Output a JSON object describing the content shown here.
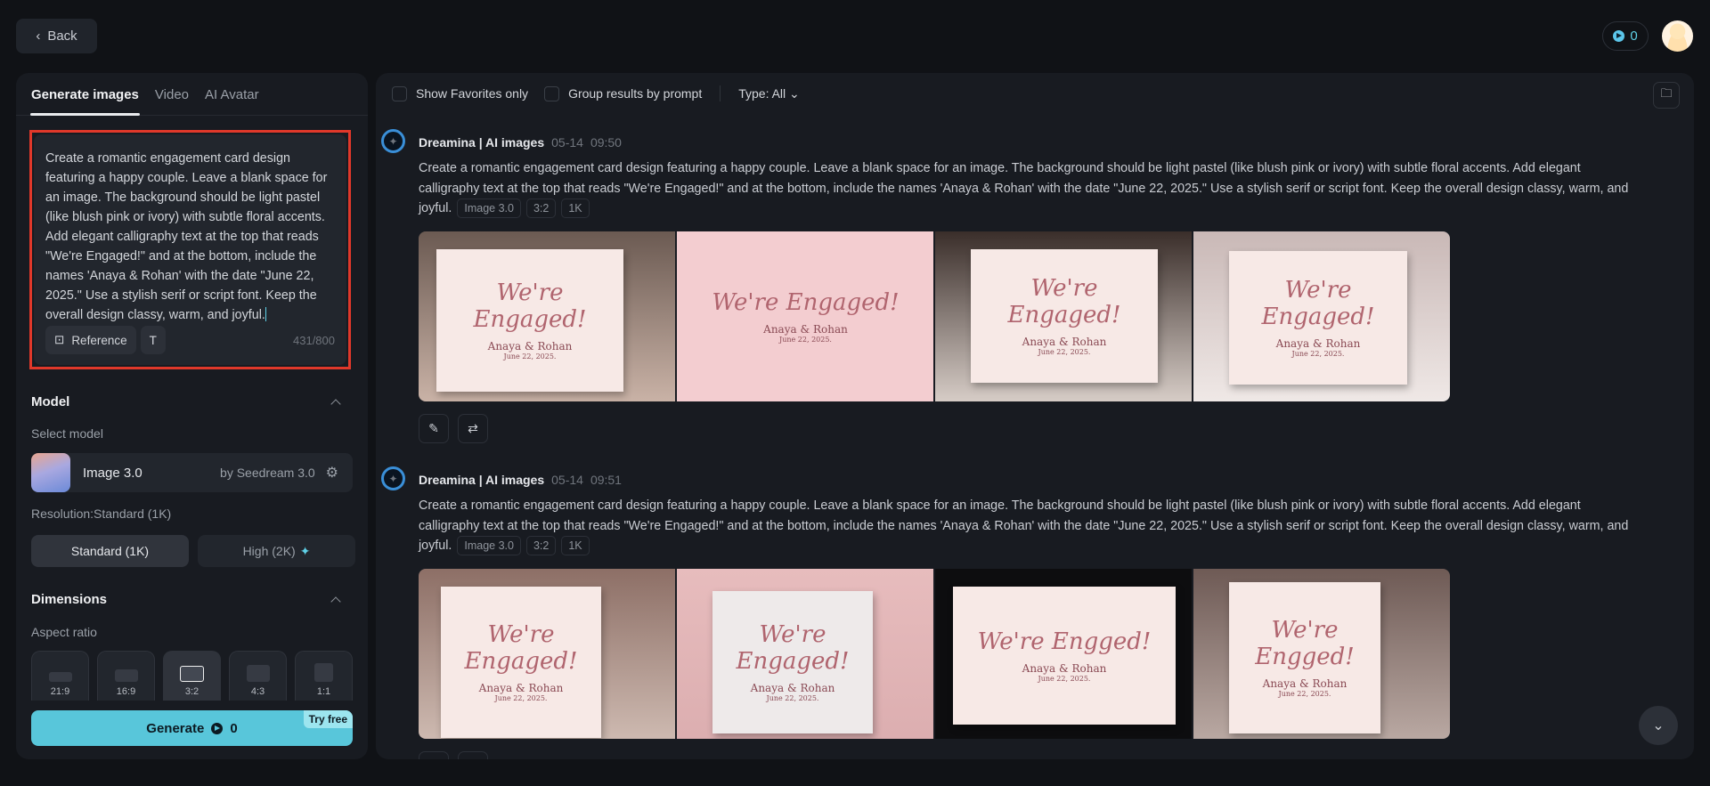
{
  "header": {
    "back_label": "Back",
    "credits": "0"
  },
  "left": {
    "tabs": [
      {
        "label": "Generate images"
      },
      {
        "label": "Video"
      },
      {
        "label": "AI Avatar"
      }
    ],
    "prompt": "Create a romantic engagement card design featuring a happy couple. Leave a blank space for an image. The background should be light pastel (like blush pink or ivory) with subtle floral accents. Add elegant calligraphy text at the top that reads \"We're Engaged!\" and at the bottom, include the names 'Anaya & Rohan' with the date \"June 22, 2025.\" Use a stylish serif or script font. Keep the overall design classy, warm, and joyful.",
    "reference_label": "Reference",
    "char_count": "431/800",
    "model_title": "Model",
    "select_model_label": "Select model",
    "model_name": "Image 3.0",
    "model_by": "by Seedream 3.0",
    "resolution_label": "Resolution:Standard (1K)",
    "res_standard": "Standard (1K)",
    "res_high": "High (2K)",
    "dimensions_title": "Dimensions",
    "aspect_label": "Aspect ratio",
    "aspect_ratios": [
      "21:9",
      "16:9",
      "3:2",
      "4:3",
      "1:1"
    ],
    "aspect_selected": "3:2",
    "generate_label": "Generate",
    "generate_cost": "0",
    "try_free": "Try free"
  },
  "toolbar": {
    "favorites": "Show Favorites only",
    "group": "Group results by prompt",
    "type": "Type: All"
  },
  "entries": [
    {
      "source": "Dreamina | AI images",
      "date": "05-14",
      "time": "09:50",
      "tags": [
        "Image 3.0",
        "3:2",
        "1K"
      ]
    },
    {
      "source": "Dreamina | AI images",
      "date": "05-14",
      "time": "09:51",
      "tags": [
        "Image 3.0",
        "3:2",
        "1K"
      ]
    }
  ],
  "card_text": {
    "title": "We're Engaged!",
    "names": "Anaya & Rohan",
    "date": "June 22, 2025.",
    "title_alt": "We're Engged!"
  },
  "colors": {
    "accent": "#58c6da",
    "highlight": "#e0382a"
  }
}
